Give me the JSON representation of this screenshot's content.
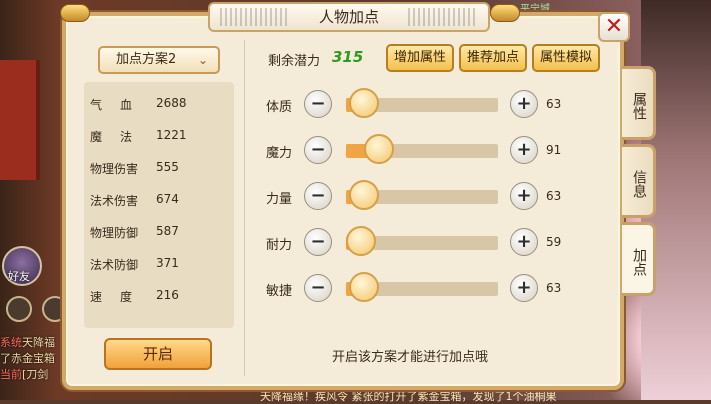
{
  "game_hud": {
    "avatar_label": "好友",
    "top_hint": "平宁城",
    "ticker_lines": [
      {
        "tag": "系统",
        "text": "天降福"
      },
      {
        "tag": "",
        "text": "了赤金宝箱"
      },
      {
        "tag": "当前",
        "text": "[刀剑"
      }
    ],
    "bottom_ticker": "天降福缘！疾风令 紧张的打开了紫金宝箱，发现了1个油桐果"
  },
  "panel": {
    "title": "人物加点",
    "close_label": "✕"
  },
  "scheme": {
    "selected": "加点方案2",
    "chevron": "⌄"
  },
  "stats": [
    {
      "label": "气血",
      "value": "2688"
    },
    {
      "label": "魔法",
      "value": "1221"
    },
    {
      "label": "物理伤害",
      "value": "555"
    },
    {
      "label": "法术伤害",
      "value": "674"
    },
    {
      "label": "物理防御",
      "value": "587"
    },
    {
      "label": "法术防御",
      "value": "371"
    },
    {
      "label": "速度",
      "value": "216"
    }
  ],
  "open_button": "开启",
  "potential": {
    "label": "剩余潜力",
    "value": "315"
  },
  "toolbar": {
    "add_attr": "增加属性",
    "recommend": "推荐加点",
    "simulate": "属性模拟"
  },
  "attributes": [
    {
      "name": "体质",
      "value": "63",
      "level": 0.12
    },
    {
      "name": "魔力",
      "value": "91",
      "level": 0.22
    },
    {
      "name": "力量",
      "value": "63",
      "level": 0.12
    },
    {
      "name": "耐力",
      "value": "59",
      "level": 0.1
    },
    {
      "name": "敏捷",
      "value": "63",
      "level": 0.12
    }
  ],
  "controls": {
    "minus": "−",
    "plus": "+"
  },
  "hint": "开启该方案才能进行加点哦",
  "side_tabs": [
    {
      "label": "属性"
    },
    {
      "label": "信息"
    },
    {
      "label": "加点"
    }
  ],
  "colors": {
    "potential": "#2d9a1e",
    "slider_fill": "#f0a545",
    "close": "#c01d1d"
  }
}
